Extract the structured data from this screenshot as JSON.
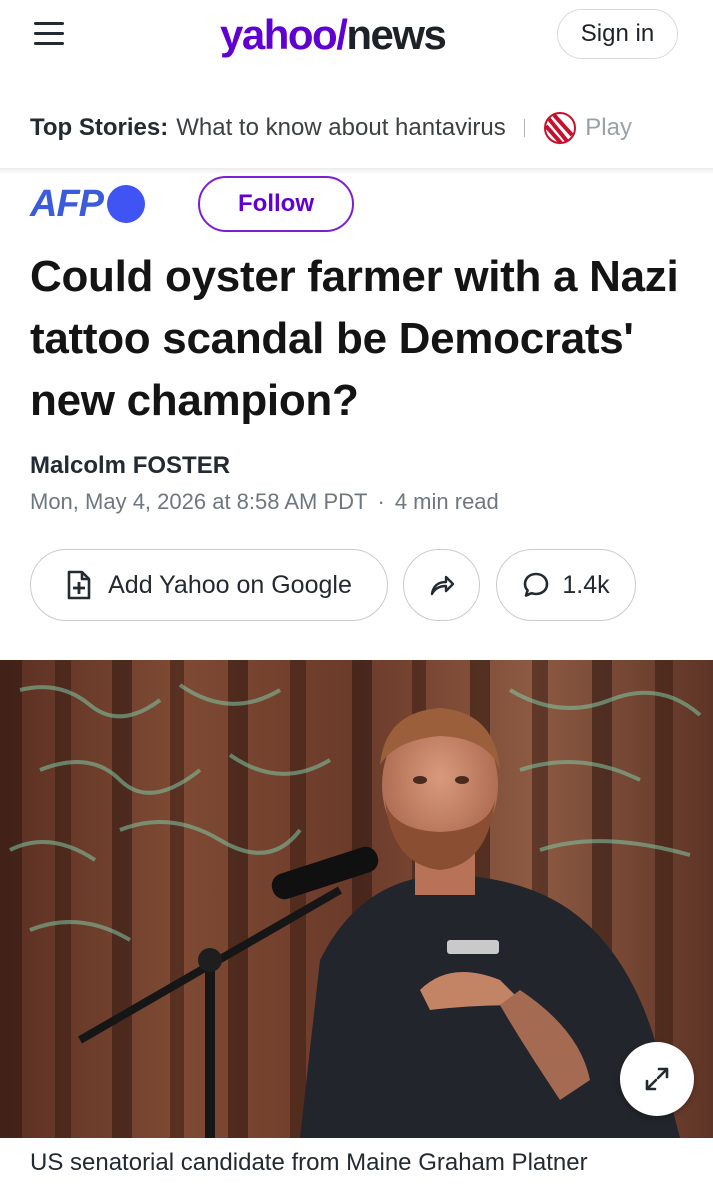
{
  "header": {
    "logo_yahoo": "yahoo",
    "logo_slash": "/",
    "logo_news": "news",
    "signin_label": "Sign in",
    "brand_color": "#6001d2"
  },
  "top_stories": {
    "label": "Top Stories:",
    "items": [
      "What to know about hantavirus",
      "Play"
    ]
  },
  "publisher": {
    "name": "AFP",
    "follow_label": "Follow",
    "logo_color": "#3b5bdb"
  },
  "article": {
    "title": "Could oyster farmer with a Nazi tattoo scandal be Democrats' new champion?",
    "author": "Malcolm FOSTER",
    "date": "Mon, May 4, 2026 at 8:58 AM PDT",
    "separator": "·",
    "read_time": "4 min read"
  },
  "actions": {
    "google_label": "Add Yahoo on Google",
    "comments_count": "1.4k",
    "icons": [
      "add-document-icon",
      "share-arrow-icon",
      "comment-bubble-icon"
    ]
  },
  "photo": {
    "caption": "US senatorial candidate from Maine Graham Platner",
    "expand_icon": "expand-icon"
  }
}
